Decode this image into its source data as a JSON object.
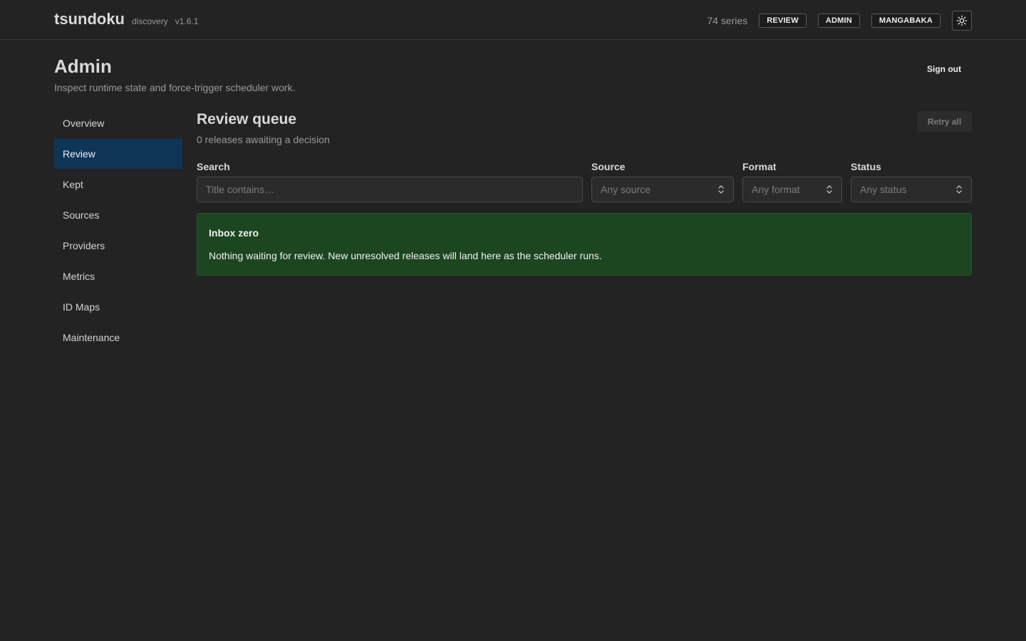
{
  "header": {
    "brand": "tsundoku",
    "tagline": "discovery",
    "version": "v1.6.1",
    "series_count": "74 series",
    "nav": [
      "REVIEW",
      "ADMIN",
      "MANGABAKA"
    ],
    "theme_icon": "sun-icon"
  },
  "page": {
    "title": "Admin",
    "subtitle": "Inspect runtime state and force-trigger scheduler work.",
    "sign_out": "Sign out"
  },
  "sidebar": {
    "active": "Review",
    "items": [
      {
        "label": "Overview"
      },
      {
        "label": "Review"
      },
      {
        "label": "Kept"
      },
      {
        "label": "Sources"
      },
      {
        "label": "Providers"
      },
      {
        "label": "Metrics"
      },
      {
        "label": "ID Maps"
      },
      {
        "label": "Maintenance"
      }
    ]
  },
  "review": {
    "title": "Review queue",
    "subtitle": "0 releases awaiting a decision",
    "retry_all": "Retry all",
    "filters": {
      "search": {
        "label": "Search",
        "placeholder": "Title contains…",
        "value": ""
      },
      "source": {
        "label": "Source",
        "value": "Any source"
      },
      "format": {
        "label": "Format",
        "value": "Any format"
      },
      "status": {
        "label": "Status",
        "value": "Any status"
      }
    },
    "empty": {
      "title": "Inbox zero",
      "message": "Nothing waiting for review. New unresolved releases will land here as the scheduler runs."
    }
  },
  "colors": {
    "background": "#232323",
    "active_nav": "#0f3556",
    "success_panel": "#1b4620"
  }
}
